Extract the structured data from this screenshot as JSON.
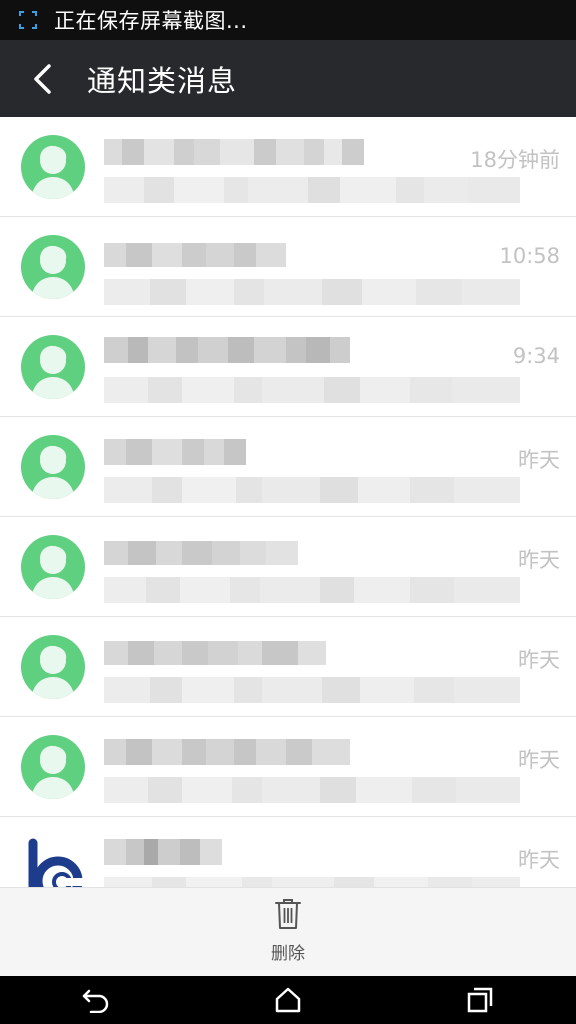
{
  "status_bar": {
    "text": "正在保存屏幕截图...",
    "icon": "screenshot-icon"
  },
  "header": {
    "title": "通知类消息",
    "back_icon": "chevron-left-icon"
  },
  "messages": [
    {
      "time": "18分钟前",
      "avatar": "default-user-avatar"
    },
    {
      "time": "10:58",
      "avatar": "default-user-avatar"
    },
    {
      "time": "9:34",
      "avatar": "default-user-avatar"
    },
    {
      "time": "昨天",
      "avatar": "default-user-avatar"
    },
    {
      "time": "昨天",
      "avatar": "default-user-avatar"
    },
    {
      "time": "昨天",
      "avatar": "default-user-avatar"
    },
    {
      "time": "昨天",
      "avatar": "default-user-avatar"
    },
    {
      "time": "昨天",
      "avatar": "bank-logo"
    }
  ],
  "action_bar": {
    "delete_label": "删除",
    "delete_icon": "trash-icon"
  },
  "nav": {
    "back_icon": "nav-back-icon",
    "home_icon": "nav-home-icon",
    "recents_icon": "nav-recents-icon"
  },
  "colors": {
    "status_bg": "#0f0f0f",
    "header_bg": "#27292d",
    "avatar_green": "#5fcf80",
    "time_gray": "#c2c2c2",
    "divider": "#e4e4e4"
  }
}
